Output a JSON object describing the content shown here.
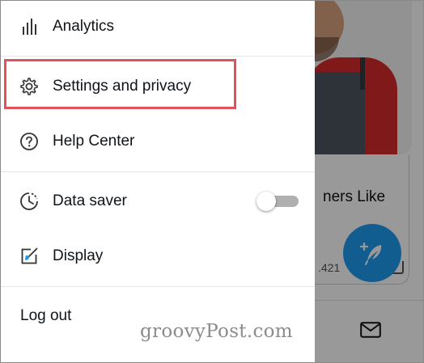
{
  "drawer": {
    "items": [
      {
        "label": "Analytics",
        "icon": "analytics-icon"
      },
      {
        "label": "Settings and privacy",
        "icon": "gear-icon"
      },
      {
        "label": "Help Center",
        "icon": "help-circle-icon"
      },
      {
        "label": "Data saver",
        "icon": "data-saver-icon"
      },
      {
        "label": "Display",
        "icon": "display-icon"
      }
    ],
    "logout_label": "Log out",
    "data_saver_toggle": {
      "on": false
    }
  },
  "background": {
    "card_text": "ners Like",
    "count_text": ".421",
    "fab_icon": "compose-feather-icon",
    "bottom_icon": "mail-icon"
  },
  "watermark": "groovyPost.com",
  "colors": {
    "highlight": "#e0535a",
    "fab": "#1d9bf0"
  }
}
